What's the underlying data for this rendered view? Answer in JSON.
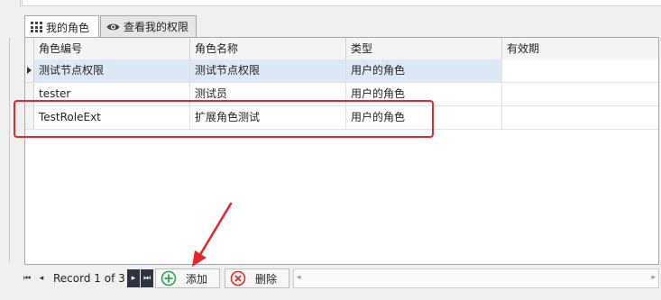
{
  "tabs": [
    {
      "label": "我的角色",
      "icon": "grid-icon",
      "active": true
    },
    {
      "label": "查看我的权限",
      "icon": "eye-icon",
      "active": false
    }
  ],
  "grid": {
    "columns": [
      "角色编号",
      "角色名称",
      "类型",
      "有效期"
    ],
    "rows": [
      {
        "code": "测试节点权限",
        "name": "测试节点权限",
        "type": "用户的角色",
        "validity": ""
      },
      {
        "code": "tester",
        "name": "测试员",
        "type": "用户的角色",
        "validity": ""
      },
      {
        "code": "TestRoleExt",
        "name": "扩展角色测试",
        "type": "用户的角色",
        "validity": ""
      }
    ],
    "selected_row": 0
  },
  "navigator": {
    "record_text": "Record 1 of 3",
    "add_label": "添加",
    "delete_label": "删除"
  },
  "colors": {
    "annotation": "#e8242b",
    "add_icon": "#2fa24a",
    "delete_icon": "#e02b2b",
    "selected_row": "#dde8f7"
  }
}
